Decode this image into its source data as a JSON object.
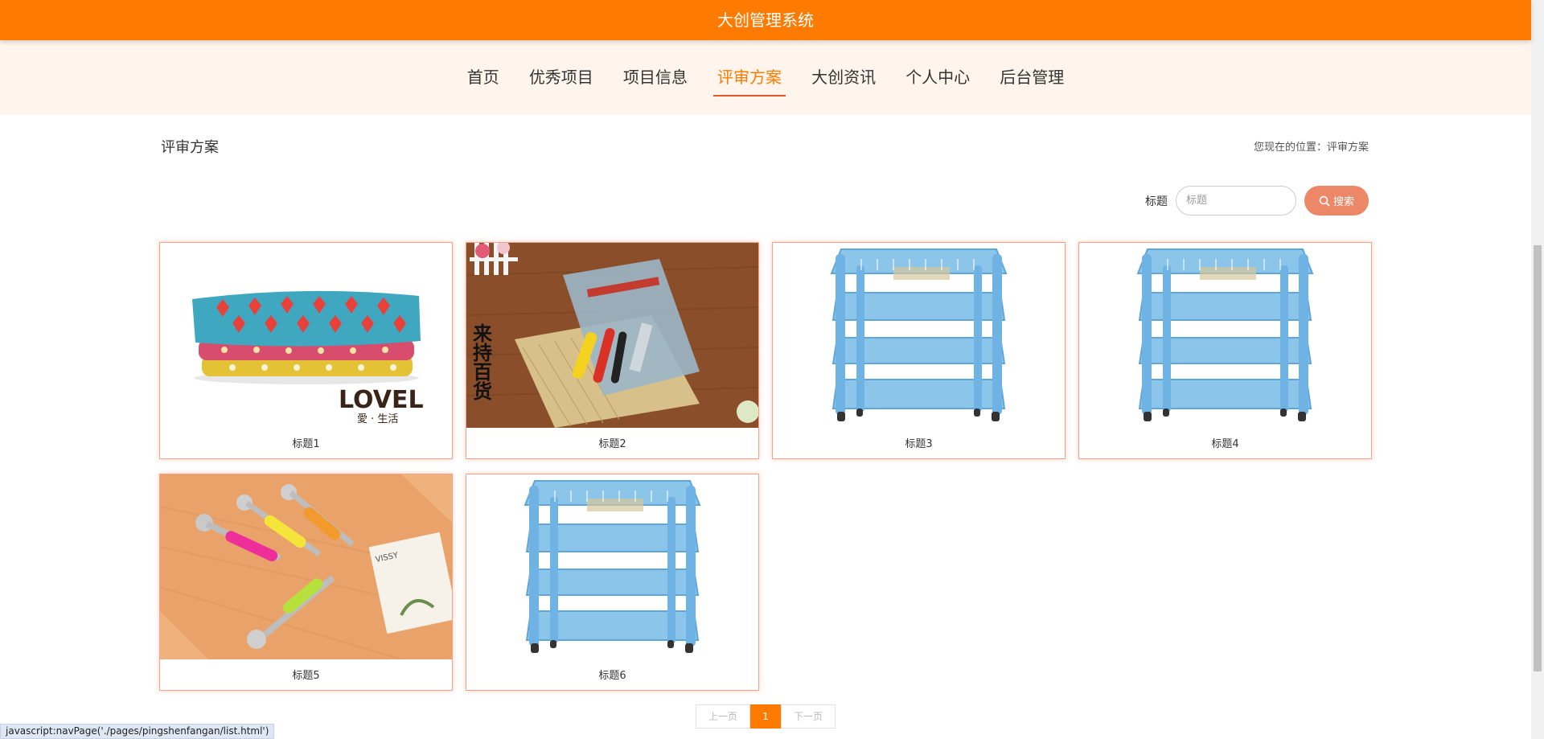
{
  "header": {
    "title": "大创管理系统"
  },
  "nav": {
    "items": [
      "首页",
      "优秀项目",
      "项目信息",
      "评审方案",
      "大创资讯",
      "个人中心",
      "后台管理"
    ],
    "active_index": 3
  },
  "page": {
    "title": "评审方案",
    "breadcrumb": "您现在的位置：评审方案"
  },
  "search": {
    "label": "标题",
    "placeholder": "标题",
    "value": "",
    "button_label": "搜索"
  },
  "cards": [
    {
      "caption": "标题1",
      "image": "folded-towels",
      "logo_text": "LOVEL",
      "logo_sub": "愛 · 生活"
    },
    {
      "caption": "标题2",
      "image": "tool-set-pack",
      "side_text": "来持百货"
    },
    {
      "caption": "标题3",
      "image": "blue-storage-rack"
    },
    {
      "caption": "标题4",
      "image": "blue-storage-rack"
    },
    {
      "caption": "标题5",
      "image": "melon-baller-tools",
      "card_text": "VISSY"
    },
    {
      "caption": "标题6",
      "image": "blue-storage-rack"
    }
  ],
  "pagination": {
    "prev_label": "上一页",
    "current": "1",
    "next_label": "下一页"
  },
  "status_bar": {
    "text": "javascript:navPage('./pages/pingshenfangan/list.html')"
  },
  "colors": {
    "brand": "#ff7a00",
    "nav_bg": "#fff5ec",
    "search_button": "#ec8768",
    "card_border": "#f3a38a"
  }
}
